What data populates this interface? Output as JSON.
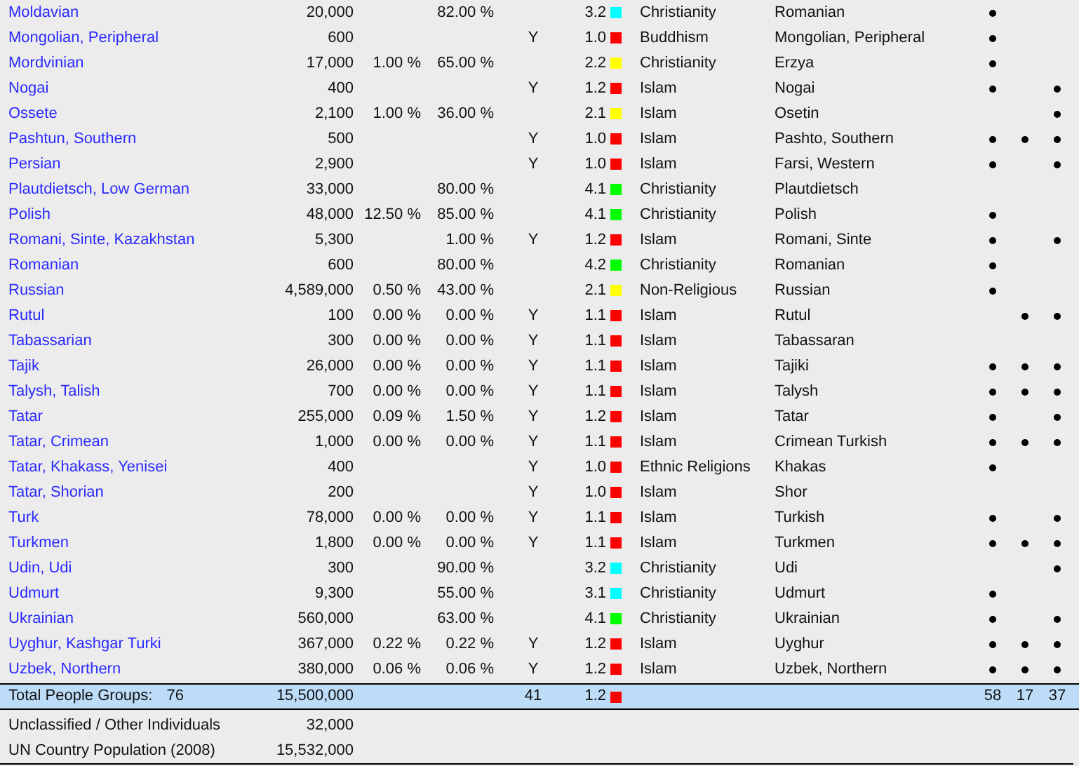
{
  "rows": [
    {
      "name": "Moldavian",
      "population": "20,000",
      "column_4": "82.00 %",
      "column_6": "3.2",
      "color": "#00ffff",
      "religion": "Christianity",
      "language": "Romanian",
      "marks": [
        true,
        false,
        false
      ]
    },
    {
      "name": "Mongolian, Peripheral",
      "population": "600",
      "column_5": "Y",
      "column_6": "1.0",
      "color": "#ff0000",
      "religion": "Buddhism",
      "language": "Mongolian, Peripheral",
      "marks": [
        true,
        false,
        false
      ]
    },
    {
      "name": "Mordvinian",
      "population": "17,000",
      "column_3": "1.00 %",
      "column_4": "65.00 %",
      "column_6": "2.2",
      "color": "#ffff00",
      "religion": "Christianity",
      "language": "Erzya",
      "marks": [
        true,
        false,
        false
      ]
    },
    {
      "name": "Nogai",
      "population": "400",
      "column_5": "Y",
      "column_6": "1.2",
      "color": "#ff0000",
      "religion": "Islam",
      "language": "Nogai",
      "marks": [
        true,
        false,
        true
      ]
    },
    {
      "name": "Ossete",
      "population": "2,100",
      "column_3": "1.00 %",
      "column_4": "36.00 %",
      "column_6": "2.1",
      "color": "#ffff00",
      "religion": "Islam",
      "language": "Osetin",
      "marks": [
        false,
        false,
        true
      ]
    },
    {
      "name": "Pashtun, Southern",
      "population": "500",
      "column_5": "Y",
      "column_6": "1.0",
      "color": "#ff0000",
      "religion": "Islam",
      "language": "Pashto, Southern",
      "marks": [
        true,
        true,
        true
      ]
    },
    {
      "name": "Persian",
      "population": "2,900",
      "column_5": "Y",
      "column_6": "1.0",
      "color": "#ff0000",
      "religion": "Islam",
      "language": "Farsi, Western",
      "marks": [
        true,
        false,
        true
      ]
    },
    {
      "name": "Plautdietsch, Low German",
      "population": "33,000",
      "column_4": "80.00 %",
      "column_6": "4.1",
      "color": "#00ff00",
      "religion": "Christianity",
      "language": "Plautdietsch",
      "marks": [
        false,
        false,
        false
      ]
    },
    {
      "name": "Polish",
      "population": "48,000",
      "column_3": "12.50 %",
      "column_4": "85.00 %",
      "column_6": "4.1",
      "color": "#00ff00",
      "religion": "Christianity",
      "language": "Polish",
      "marks": [
        true,
        false,
        false
      ]
    },
    {
      "name": "Romani, Sinte, Kazakhstan",
      "population": "5,300",
      "column_4": "1.00 %",
      "column_5": "Y",
      "column_6": "1.2",
      "color": "#ff0000",
      "religion": "Islam",
      "language": "Romani, Sinte",
      "marks": [
        true,
        false,
        true
      ]
    },
    {
      "name": "Romanian",
      "population": "600",
      "column_4": "80.00 %",
      "column_6": "4.2",
      "color": "#00ff00",
      "religion": "Christianity",
      "language": "Romanian",
      "marks": [
        true,
        false,
        false
      ]
    },
    {
      "name": "Russian",
      "population": "4,589,000",
      "column_3": "0.50 %",
      "column_4": "43.00 %",
      "column_6": "2.1",
      "color": "#ffff00",
      "religion": "Non-Religious",
      "language": "Russian",
      "marks": [
        true,
        false,
        false
      ]
    },
    {
      "name": "Rutul",
      "population": "100",
      "column_3": "0.00 %",
      "column_4": "0.00 %",
      "column_5": "Y",
      "column_6": "1.1",
      "color": "#ff0000",
      "religion": "Islam",
      "language": "Rutul",
      "marks": [
        false,
        true,
        true
      ]
    },
    {
      "name": "Tabassarian",
      "population": "300",
      "column_3": "0.00 %",
      "column_4": "0.00 %",
      "column_5": "Y",
      "column_6": "1.1",
      "color": "#ff0000",
      "religion": "Islam",
      "language": "Tabassaran",
      "marks": [
        false,
        false,
        false
      ]
    },
    {
      "name": "Tajik",
      "population": "26,000",
      "column_3": "0.00 %",
      "column_4": "0.00 %",
      "column_5": "Y",
      "column_6": "1.1",
      "color": "#ff0000",
      "religion": "Islam",
      "language": "Tajiki",
      "marks": [
        true,
        true,
        true
      ]
    },
    {
      "name": "Talysh, Talish",
      "population": "700",
      "column_3": "0.00 %",
      "column_4": "0.00 %",
      "column_5": "Y",
      "column_6": "1.1",
      "color": "#ff0000",
      "religion": "Islam",
      "language": "Talysh",
      "marks": [
        true,
        true,
        true
      ]
    },
    {
      "name": "Tatar",
      "population": "255,000",
      "column_3": "0.09 %",
      "column_4": "1.50 %",
      "column_5": "Y",
      "column_6": "1.2",
      "color": "#ff0000",
      "religion": "Islam",
      "language": "Tatar",
      "marks": [
        true,
        false,
        true
      ]
    },
    {
      "name": "Tatar, Crimean",
      "population": "1,000",
      "column_3": "0.00 %",
      "column_4": "0.00 %",
      "column_5": "Y",
      "column_6": "1.1",
      "color": "#ff0000",
      "religion": "Islam",
      "language": "Crimean Turkish",
      "marks": [
        true,
        true,
        true
      ]
    },
    {
      "name": "Tatar, Khakass, Yenisei",
      "population": "400",
      "column_5": "Y",
      "column_6": "1.0",
      "color": "#ff0000",
      "religion": "Ethnic Religions",
      "language": "Khakas",
      "marks": [
        true,
        false,
        false
      ]
    },
    {
      "name": "Tatar, Shorian",
      "population": "200",
      "column_5": "Y",
      "column_6": "1.0",
      "color": "#ff0000",
      "religion": "Islam",
      "language": "Shor",
      "marks": [
        false,
        false,
        false
      ]
    },
    {
      "name": "Turk",
      "population": "78,000",
      "column_3": "0.00 %",
      "column_4": "0.00 %",
      "column_5": "Y",
      "column_6": "1.1",
      "color": "#ff0000",
      "religion": "Islam",
      "language": "Turkish",
      "marks": [
        true,
        false,
        true
      ]
    },
    {
      "name": "Turkmen",
      "population": "1,800",
      "column_3": "0.00 %",
      "column_4": "0.00 %",
      "column_5": "Y",
      "column_6": "1.1",
      "color": "#ff0000",
      "religion": "Islam",
      "language": "Turkmen",
      "marks": [
        true,
        true,
        true
      ]
    },
    {
      "name": "Udin, Udi",
      "population": "300",
      "column_4": "90.00 %",
      "column_6": "3.2",
      "color": "#00ffff",
      "religion": "Christianity",
      "language": "Udi",
      "marks": [
        false,
        false,
        true
      ]
    },
    {
      "name": "Udmurt",
      "population": "9,300",
      "column_4": "55.00 %",
      "column_6": "3.1",
      "color": "#00ffff",
      "religion": "Christianity",
      "language": "Udmurt",
      "marks": [
        true,
        false,
        false
      ]
    },
    {
      "name": "Ukrainian",
      "population": "560,000",
      "column_4": "63.00 %",
      "column_6": "4.1",
      "color": "#00ff00",
      "religion": "Christianity",
      "language": "Ukrainian",
      "marks": [
        true,
        false,
        true
      ]
    },
    {
      "name": "Uyghur, Kashgar Turki",
      "population": "367,000",
      "column_3": "0.22 %",
      "column_4": "0.22 %",
      "column_5": "Y",
      "column_6": "1.2",
      "color": "#ff0000",
      "religion": "Islam",
      "language": "Uyghur",
      "marks": [
        true,
        true,
        true
      ]
    },
    {
      "name": "Uzbek, Northern",
      "population": "380,000",
      "column_3": "0.06 %",
      "column_4": "0.06 %",
      "column_5": "Y",
      "column_6": "1.2",
      "color": "#ff0000",
      "religion": "Islam",
      "language": "Uzbek, Northern",
      "marks": [
        true,
        true,
        true
      ]
    }
  ],
  "total": {
    "label": "Total People Groups:",
    "count": "76",
    "population": "15,500,000",
    "column_5": "41",
    "column_6": "1.2",
    "color": "#ff0000",
    "marks": [
      "58",
      "17",
      "37"
    ]
  },
  "footer": [
    {
      "label": "Unclassified / Other Individuals",
      "population": "32,000"
    },
    {
      "label": "UN Country Population (2008)",
      "population": "15,532,000"
    }
  ]
}
